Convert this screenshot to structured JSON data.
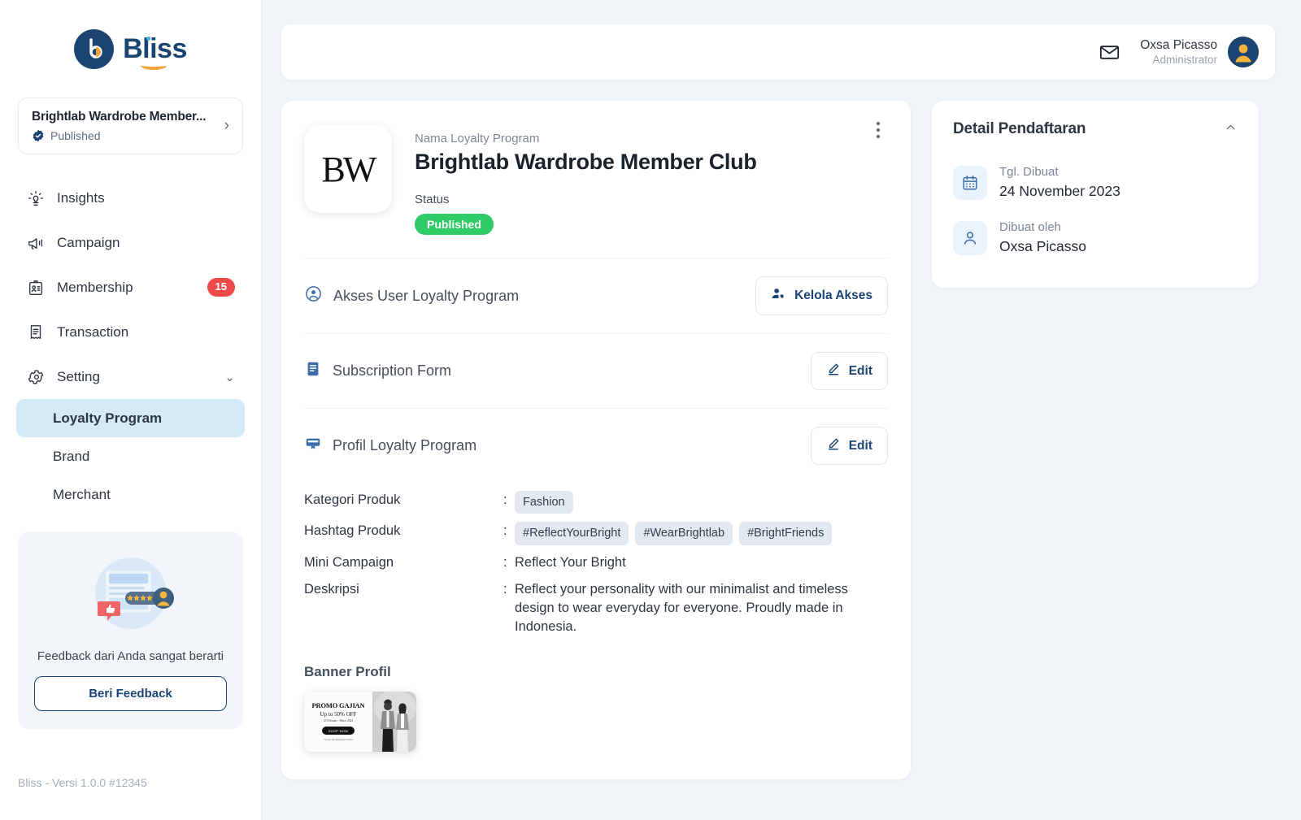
{
  "brand": {
    "name": "Bliss",
    "version": "Bliss - Versi 1.0.0 #12345"
  },
  "sidebar": {
    "program_card": {
      "name": "Brightlab Wardrobe Member...",
      "status": "Published"
    },
    "items": [
      {
        "label": "Insights",
        "icon": "lightbulb-icon",
        "badge": ""
      },
      {
        "label": "Campaign",
        "icon": "megaphone-icon",
        "badge": ""
      },
      {
        "label": "Membership",
        "icon": "id-card-icon",
        "badge": "15"
      },
      {
        "label": "Transaction",
        "icon": "receipt-icon",
        "badge": ""
      },
      {
        "label": "Setting",
        "icon": "gear-icon",
        "badge": ""
      }
    ],
    "subitems": [
      {
        "label": "Loyalty Program",
        "active": true
      },
      {
        "label": "Brand",
        "active": false
      },
      {
        "label": "Merchant",
        "active": false
      }
    ],
    "feedback": {
      "text": "Feedback dari Anda sangat berarti",
      "button": "Beri Feedback"
    }
  },
  "topbar": {
    "user_name": "Oxsa Picasso",
    "user_role": "Administrator"
  },
  "program": {
    "logo_text": "BW",
    "name_label": "Nama Loyalty Program",
    "name": "Brightlab Wardrobe Member Club",
    "status_label": "Status",
    "status": "Published",
    "sections": [
      {
        "title": "Akses User Loyalty Program",
        "icon": "user-circle-icon",
        "action": "Kelola Akses",
        "action_icon": "user-cog-icon"
      },
      {
        "title": "Subscription Form",
        "icon": "form-icon",
        "action": "Edit",
        "action_icon": "pencil-icon"
      },
      {
        "title": "Profil Loyalty Program",
        "icon": "display-icon",
        "action": "Edit",
        "action_icon": "pencil-icon"
      }
    ],
    "details": [
      {
        "key": "Kategori Produk",
        "type": "tags",
        "values": [
          "Fashion"
        ]
      },
      {
        "key": "Hashtag Produk",
        "type": "tags",
        "values": [
          "#ReflectYourBright",
          "#WearBrightlab",
          "#BrightFriends"
        ]
      },
      {
        "key": "Mini Campaign",
        "type": "text",
        "value": "Reflect Your Bright"
      },
      {
        "key": "Deskripsi",
        "type": "text",
        "value": "Reflect your personality with our minimalist and timeless design to wear everyday for everyone. Proudly made in Indonesia."
      }
    ],
    "banner_label": "Banner Profil",
    "banner": {
      "line1": "PROMO GAJIAN",
      "line2": "Up to 50% OFF",
      "line3": "25 Februari - Maret 2024",
      "cta": "SHOP NOW",
      "fine_print": "*Syarat dan ketentuan berlaku"
    }
  },
  "right_panel": {
    "title": "Detail Pendaftaran",
    "rows": [
      {
        "key": "Tgl. Dibuat",
        "value": "24 November 2023",
        "icon": "calendar-icon"
      },
      {
        "key": "Dibuat oleh",
        "value": "Oxsa Picasso",
        "icon": "person-icon"
      }
    ]
  },
  "colors": {
    "brand_navy": "#1b4471",
    "accent_blue": "#d4eaf8",
    "success_green": "#2ecb67",
    "danger_red": "#ef4a4a",
    "page_bg": "#eff4f9"
  }
}
